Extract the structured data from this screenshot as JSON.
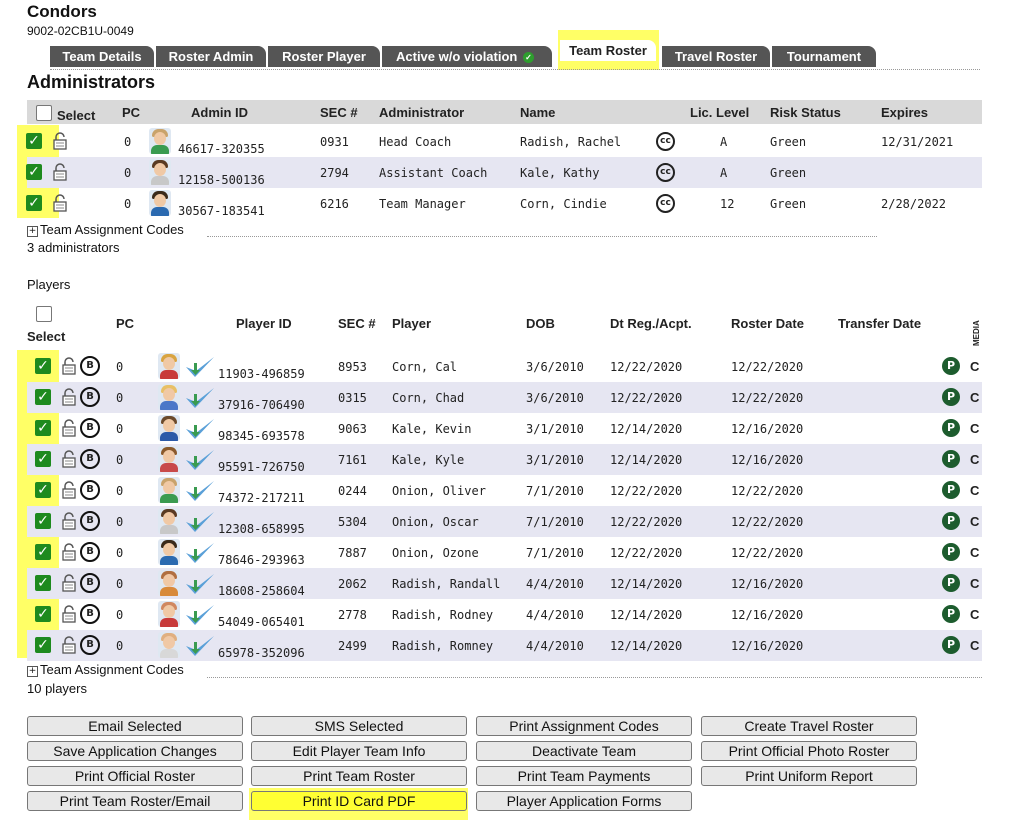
{
  "team": {
    "name": "Condors",
    "code": "9002-02CB1U-0049"
  },
  "tabs": [
    {
      "label": "Team Details"
    },
    {
      "label": "Roster Admin"
    },
    {
      "label": "Roster Player"
    },
    {
      "label": "Active w/o violation"
    },
    {
      "label": "Team Roster"
    },
    {
      "label": "Travel Roster"
    },
    {
      "label": "Tournament"
    }
  ],
  "admins": {
    "heading": "Administrators",
    "columns": {
      "select": "Select",
      "pc": "PC",
      "admin_id": "Admin ID",
      "sec": "SEC #",
      "administrator": "Administrator",
      "name": "Name",
      "lic_level": "Lic. Level",
      "risk_status": "Risk Status",
      "expires": "Expires"
    },
    "rows": [
      {
        "pc": "0",
        "admin_id": "46617-320355",
        "sec": "0931",
        "role": "Head Coach",
        "name": "Radish, Rachel",
        "cc": "cc",
        "lic": "A",
        "risk": "Green",
        "expires": "12/31/2021"
      },
      {
        "pc": "0",
        "admin_id": "12158-500136",
        "sec": "2794",
        "role": "Assistant Coach",
        "name": "Kale, Kathy",
        "cc": "cc",
        "lic": "A",
        "risk": "Green",
        "expires": ""
      },
      {
        "pc": "0",
        "admin_id": "30567-183541",
        "sec": "6216",
        "role": "Team Manager",
        "name": "Corn, Cindie",
        "cc": "cc",
        "lic": "12",
        "risk": "Green",
        "expires": "2/28/2022"
      }
    ],
    "assignment_codes_label": "Team Assignment Codes",
    "count_label": "3 administrators"
  },
  "players": {
    "heading": "Players",
    "columns": {
      "select": "Select",
      "pc": "PC",
      "player_id": "Player ID",
      "sec": "SEC #",
      "player": "Player",
      "dob": "DOB",
      "dt_reg": "Dt Reg./Acpt.",
      "roster_date": "Roster Date",
      "transfer_date": "Transfer Date",
      "media": "MEDIA"
    },
    "rows": [
      {
        "pc": "0",
        "player_id": "11903-496859",
        "sec": "8953",
        "name": "Corn, Cal",
        "dob": "3/6/2010",
        "dt_reg": "12/22/2020",
        "roster_date": "12/22/2020",
        "transfer": "",
        "p": "P",
        "media": "C"
      },
      {
        "pc": "0",
        "player_id": "37916-706490",
        "sec": "0315",
        "name": "Corn, Chad",
        "dob": "3/6/2010",
        "dt_reg": "12/22/2020",
        "roster_date": "12/22/2020",
        "transfer": "",
        "p": "P",
        "media": "C"
      },
      {
        "pc": "0",
        "player_id": "98345-693578",
        "sec": "9063",
        "name": "Kale, Kevin",
        "dob": "3/1/2010",
        "dt_reg": "12/14/2020",
        "roster_date": "12/16/2020",
        "transfer": "",
        "p": "P",
        "media": "C"
      },
      {
        "pc": "0",
        "player_id": "95591-726750",
        "sec": "7161",
        "name": "Kale, Kyle",
        "dob": "3/1/2010",
        "dt_reg": "12/14/2020",
        "roster_date": "12/16/2020",
        "transfer": "",
        "p": "P",
        "media": "C"
      },
      {
        "pc": "0",
        "player_id": "74372-217211",
        "sec": "0244",
        "name": "Onion, Oliver",
        "dob": "7/1/2010",
        "dt_reg": "12/22/2020",
        "roster_date": "12/22/2020",
        "transfer": "",
        "p": "P",
        "media": "C"
      },
      {
        "pc": "0",
        "player_id": "12308-658995",
        "sec": "5304",
        "name": "Onion, Oscar",
        "dob": "7/1/2010",
        "dt_reg": "12/22/2020",
        "roster_date": "12/22/2020",
        "transfer": "",
        "p": "P",
        "media": "C"
      },
      {
        "pc": "0",
        "player_id": "78646-293963",
        "sec": "7887",
        "name": "Onion, Ozone",
        "dob": "7/1/2010",
        "dt_reg": "12/22/2020",
        "roster_date": "12/22/2020",
        "transfer": "",
        "p": "P",
        "media": "C"
      },
      {
        "pc": "0",
        "player_id": "18608-258604",
        "sec": "2062",
        "name": "Radish, Randall",
        "dob": "4/4/2010",
        "dt_reg": "12/14/2020",
        "roster_date": "12/16/2020",
        "transfer": "",
        "p": "P",
        "media": "C"
      },
      {
        "pc": "0",
        "player_id": "54049-065401",
        "sec": "2778",
        "name": "Radish, Rodney",
        "dob": "4/4/2010",
        "dt_reg": "12/14/2020",
        "roster_date": "12/16/2020",
        "transfer": "",
        "p": "P",
        "media": "C"
      },
      {
        "pc": "0",
        "player_id": "65978-352096",
        "sec": "2499",
        "name": "Radish, Romney",
        "dob": "4/4/2010",
        "dt_reg": "12/14/2020",
        "roster_date": "12/16/2020",
        "transfer": "",
        "p": "P",
        "media": "C"
      }
    ],
    "assignment_codes_label": "Team Assignment Codes",
    "count_label": "10 players"
  },
  "buttons": [
    {
      "label": "Email Selected"
    },
    {
      "label": "SMS Selected"
    },
    {
      "label": "Print Assignment Codes"
    },
    {
      "label": "Create Travel Roster"
    },
    {
      "label": "Save Application Changes"
    },
    {
      "label": "Edit Player Team Info"
    },
    {
      "label": "Deactivate Team"
    },
    {
      "label": "Print Official Photo Roster"
    },
    {
      "label": "Print Official Roster"
    },
    {
      "label": "Print Team Roster"
    },
    {
      "label": "Print Team Payments"
    },
    {
      "label": "Print Uniform Report"
    },
    {
      "label": "Print Team Roster/Email"
    },
    {
      "label": "Print ID Card PDF"
    },
    {
      "label": "Player Application Forms"
    }
  ],
  "icons": {
    "checkbox": "checkbox-checked-icon",
    "lock": "padlock-icon",
    "birth_cert": "b-circle-icon",
    "cc": "cc-badge-icon",
    "verified": "verified-check-icon",
    "pass": "p-circle-icon",
    "expand": "plus-box-icon"
  },
  "colors": {
    "tab_bg": "#555555",
    "highlight": "#ffff66",
    "check_green": "#1e8a1e",
    "row_alt": "#e6e6f2",
    "p_badge": "#1d5c2e"
  }
}
